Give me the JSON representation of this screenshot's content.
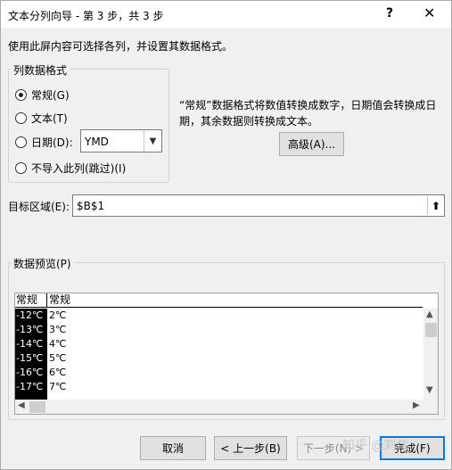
{
  "window": {
    "title": "文本分列向导 - 第 3 步，共 3 步",
    "help": "?",
    "close": "✕"
  },
  "intro": "使用此屏内容可选择各列，并设置其数据格式。",
  "format_group": {
    "label": "列数据格式",
    "options": [
      {
        "label": "常规(G)",
        "selected": true
      },
      {
        "label": "文本(T)",
        "selected": false
      },
      {
        "label": "日期(D):",
        "selected": false
      },
      {
        "label": "不导入此列(跳过)(I)",
        "selected": false
      }
    ],
    "date_format": "YMD"
  },
  "description": "“常规”数据格式将数值转换成数字，日期值会转换成日期，其余数据则转换成文本。",
  "advanced_button": "高级(A)...",
  "destination": {
    "label": "目标区域(E):",
    "value": "$B$1"
  },
  "preview": {
    "label": "数据预览(P)",
    "headers": [
      "常规",
      "常规"
    ],
    "rows": [
      [
        "-12℃",
        "2℃"
      ],
      [
        "-13℃",
        "3℃"
      ],
      [
        "-14℃",
        "4℃"
      ],
      [
        "-15℃",
        "5℃"
      ],
      [
        "-16℃",
        "6℃"
      ],
      [
        "-17℃",
        "7℃"
      ]
    ]
  },
  "buttons": {
    "cancel": "取消",
    "back": "< 上一步(B)",
    "next": "下一步(N) >",
    "finish": "完成(F)"
  },
  "watermark": "知乎 @刘伟"
}
